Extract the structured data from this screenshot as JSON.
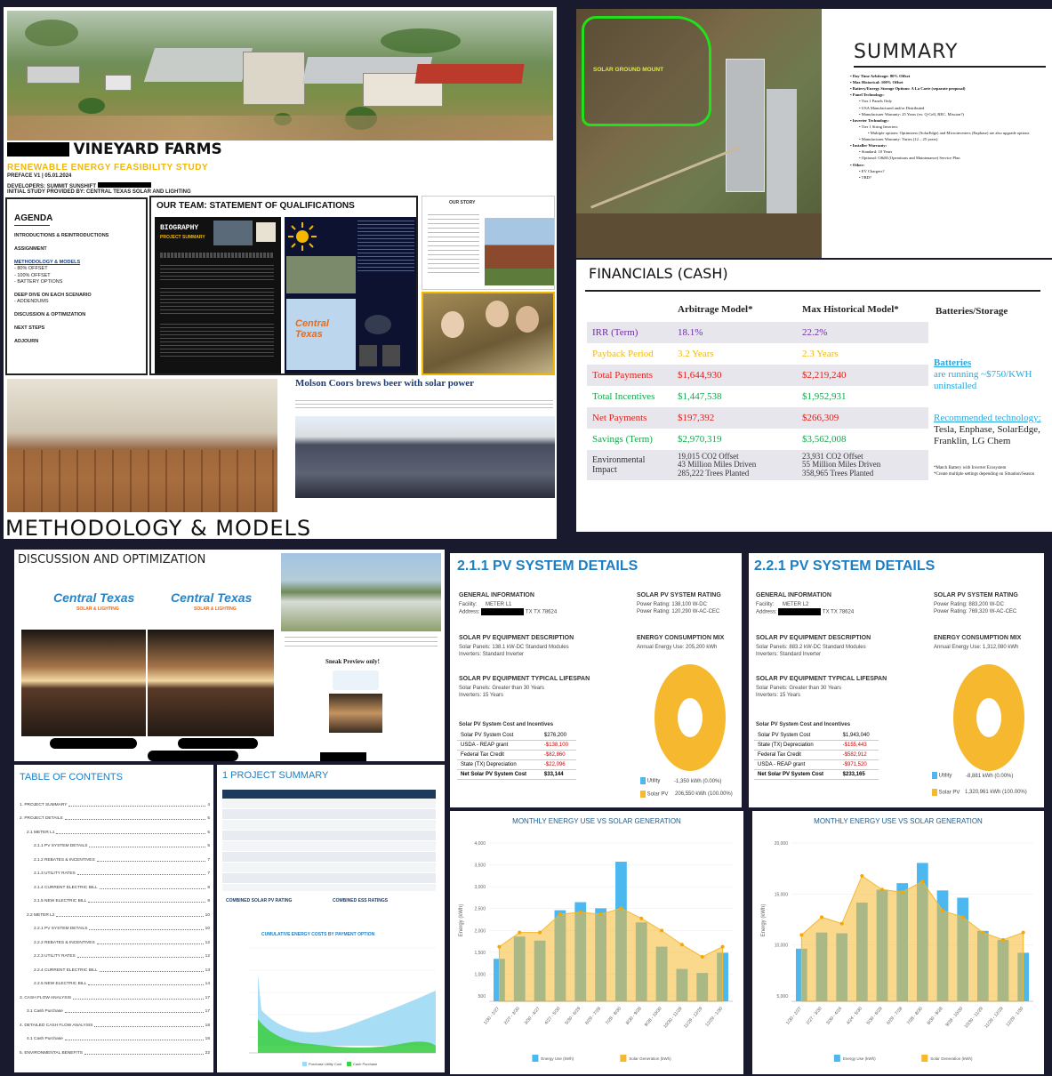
{
  "vineyard": {
    "title": "VINEYARD FARMS",
    "subtitle": "RENEWABLE ENERGY FEASIBILITY STUDY",
    "preface": "PREFACE V1 | 05.01.2024",
    "developers": "DEVELOPERS: SUMMIT SUNSHIFT",
    "initial_study": "INITIAL STUDY PROVIDED BY: CENTRAL TEXAS SOLAR AND LIGHTING"
  },
  "agenda": {
    "heading": "AGENDA",
    "items": [
      "INTRODUCTIONS & REINTRODUCTIONS",
      "ASSIGNMENT",
      "METHODOLOGY & MODELS",
      "- 80% OFFSET",
      "- 100% OFFSET",
      "- BATTERY OPTIONS",
      "DEEP DIVE ON EACH SCENARIO",
      "- ADDENDUMS",
      "DISCUSSION & OPTIMIZATION",
      "NEXT STEPS",
      "ADJOURN"
    ]
  },
  "team": {
    "heading": "OUR TEAM: STATEMENT OF QUALIFICATIONS",
    "bio_label": "BIOGRAPHY",
    "bio_sub": "PROJECT SUMMARY",
    "logo_text": "Central Texas",
    "our_story": "OUR STORY"
  },
  "news": {
    "headline": "Molson Coors brews beer with solar power"
  },
  "methodology": {
    "heading": "METHODOLOGY & MODELS"
  },
  "aerial": {
    "label": "SOLAR GROUND MOUNT"
  },
  "summary": {
    "heading": "SUMMARY",
    "items": [
      "Day Time Arbitrage: 80% Offset",
      "Max Historical: 100% Offset",
      "Battery/Energy Storage Options: A La Carte (separate proposal)",
      "Panel Technology:",
      "Tier 1 Panels Only",
      "USA Manufactured and/or Distributed",
      "Manufacturer Warranty: 25 Years (ex: Q-Cell, REC, Mission?)",
      "Inverter Technology:",
      "Tier 1 String Inverters",
      "Multiple options: Optimizers (SolarEdge) and Microinverters (Enphase) are also upgrade options",
      "Manufacturer Warranty: Varies (12 – 25 years)",
      "Installer Warranty:",
      "Standard: 10 Years",
      "Optional: O&M (Operations and Maintenance) Service Plan",
      "Other:",
      "EV Chargers?",
      "TBD?"
    ]
  },
  "financials": {
    "heading": "FINANCIALS (CASH)",
    "columns": [
      "",
      "Arbitrage Model*",
      "Max Historical Model*",
      "Batteries/Storage"
    ],
    "rows": [
      {
        "label": "IRR (Term)",
        "a": "18.1%",
        "b": "22.2%",
        "color": "#7030a0"
      },
      {
        "label": "Payback Period",
        "a": "3.2 Years",
        "b": "2.3 Years",
        "color": "#f5b800"
      },
      {
        "label": "Total Payments",
        "a": "$1,644,930",
        "b": "$2,219,240",
        "color": "#e0201b"
      },
      {
        "label": "Total Incentives",
        "a": "$1,447,538",
        "b": "$1,952,931",
        "color": "#11a84a"
      },
      {
        "label": "Net Payments",
        "a": "$197,392",
        "b": "$266,309",
        "color": "#e0201b"
      },
      {
        "label": "Savings (Term)",
        "a": "$2,970,319",
        "b": "$3,562,008",
        "color": "#11a84a"
      },
      {
        "label": "Environmental Impact",
        "a": "19,015 CO2 Offset\n43 Million Miles Driven\n285,222 Trees Planted",
        "b": "23,931 CO2 Offset\n55 Million Miles Driven\n358,965 Trees Planted",
        "color": "#333333"
      }
    ],
    "batteries_title": "Batteries",
    "batteries_text": "are running ~$750/KWH uninstalled",
    "recommended_title": "Recommended technology:",
    "recommended_text": "Tesla, Enphase, SolarEdge, Franklin, LG Chem",
    "note1": "*Match Battery with Inverter Ecosystem",
    "note2": "*Create multiple settings depending on Situation/Season"
  },
  "discussion": {
    "heading": "DISCUSSION AND OPTIMIZATION",
    "logo_text": "Central Texas",
    "logo_sub": "SOLAR & LIGHTING",
    "sneak": "Sneak Preview only!"
  },
  "toc": {
    "heading": "TABLE OF CONTENTS",
    "items": [
      {
        "t": "1. PROJECT SUMMARY",
        "p": "4"
      },
      {
        "t": "2. PROJECT DETAILS",
        "p": "5"
      },
      {
        "t": "2.1 METER L1",
        "p": "5"
      },
      {
        "t": "2.1.1 PV SYSTEM DETAILS",
        "p": "5"
      },
      {
        "t": "2.1.2 REBATES & INCENTIVES",
        "p": "7"
      },
      {
        "t": "2.1.3 UTILITY RATES",
        "p": "7"
      },
      {
        "t": "2.1.4 CURRENT ELECTRIC BILL",
        "p": "8"
      },
      {
        "t": "2.1.5 NEW ELECTRIC BILL",
        "p": "9"
      },
      {
        "t": "2.2 METER L2",
        "p": "10"
      },
      {
        "t": "2.2.1 PV SYSTEM DETAILS",
        "p": "10"
      },
      {
        "t": "2.2.2 REBATES & INCENTIVES",
        "p": "12"
      },
      {
        "t": "2.2.3 UTILITY RATES",
        "p": "12"
      },
      {
        "t": "2.2.4 CURRENT ELECTRIC BILL",
        "p": "13"
      },
      {
        "t": "2.2.5 NEW ELECTRIC BILL",
        "p": "14"
      },
      {
        "t": "3. CASH FLOW ANALYSIS",
        "p": "17"
      },
      {
        "t": "3.1 Cash Purchase",
        "p": "17"
      },
      {
        "t": "4. DETAILED CASH FLOW ANALYSIS",
        "p": "18"
      },
      {
        "t": "4.1 Cash Purchase",
        "p": "18"
      },
      {
        "t": "5. ENVIRONMENTAL BENEFITS",
        "p": "22"
      }
    ]
  },
  "projsum": {
    "heading": "1 PROJECT SUMMARY",
    "combined_pv": "COMBINED SOLAR PV RATING",
    "combined_ess": "COMBINED ESS RATINGS",
    "chart_title": "CUMULATIVE ENERGY COSTS BY PAYMENT OPTION",
    "legend": [
      "Purchase Utility Cost",
      "Cash Purchase"
    ]
  },
  "pv1": {
    "heading": "2.1.1 PV SYSTEM DETAILS",
    "gen_info": "GENERAL INFORMATION",
    "facility": "Facility:",
    "facility_val": "METER L1",
    "address": "Address:",
    "address_val": "TX TX 78624",
    "rating_h": "SOLAR PV SYSTEM RATING",
    "rating1": "Power Rating: 138,100 W-DC",
    "rating2": "Power Rating: 120,290 W-AC-CEC",
    "equip_h": "SOLAR PV EQUIPMENT DESCRIPTION",
    "panels": "Solar Panels: 138.1 kW-DC Standard Modules",
    "inverters": "Inverters: Standard Inverter",
    "mix_h": "ENERGY CONSUMPTION MIX",
    "annual": "Annual Energy Use: 205,200 kWh",
    "life_h": "SOLAR PV EQUIPMENT TYPICAL LIFESPAN",
    "life1": "Solar Panels: Greater than 30 Years",
    "life2": "Inverters: 15 Years",
    "cost_h": "Solar PV System Cost and Incentives",
    "costs": [
      {
        "k": "Solar PV System Cost",
        "v": "$276,200",
        "neg": false
      },
      {
        "k": "USDA - REAP grant",
        "v": "-$138,100",
        "neg": true
      },
      {
        "k": "Federal Tax Credit",
        "v": "-$82,860",
        "neg": true
      },
      {
        "k": "State (TX) Depreciation",
        "v": "-$22,096",
        "neg": true
      }
    ],
    "net_k": "Net Solar PV System Cost",
    "net_v": "$33,144",
    "leg_utility": "Utility",
    "leg_utility_val": "-1,350 kWh (0.00%)",
    "leg_solar": "Solar PV",
    "leg_solar_val": "206,550 kWh (100.00%)"
  },
  "pv2": {
    "heading": "2.2.1 PV SYSTEM DETAILS",
    "gen_info": "GENERAL INFORMATION",
    "facility": "Facility:",
    "facility_val": "METER L2",
    "address": "Address:",
    "address_val": "TX TX 78624",
    "rating_h": "SOLAR PV SYSTEM RATING",
    "rating1": "Power Rating: 883,200 W-DC",
    "rating2": "Power Rating: 769,320 W-AC-CEC",
    "equip_h": "SOLAR PV EQUIPMENT DESCRIPTION",
    "panels": "Solar Panels: 883.2 kW-DC Standard Modules",
    "inverters": "Inverters: Standard Inverter",
    "mix_h": "ENERGY CONSUMPTION MIX",
    "annual": "Annual Energy Use: 1,312,080 kWh",
    "life_h": "SOLAR PV EQUIPMENT TYPICAL LIFESPAN",
    "life1": "Solar Panels: Greater than 30 Years",
    "life2": "Inverters: 15 Years",
    "cost_h": "Solar PV System Cost and Incentives",
    "costs": [
      {
        "k": "Solar PV System Cost",
        "v": "$1,943,040",
        "neg": false
      },
      {
        "k": "State (TX) Depreciation",
        "v": "-$155,443",
        "neg": true
      },
      {
        "k": "Federal Tax Credit",
        "v": "-$582,912",
        "neg": true
      },
      {
        "k": "USDA - REAP grant",
        "v": "-$971,520",
        "neg": true
      }
    ],
    "net_k": "Net Solar PV System Cost",
    "net_v": "$233,165",
    "leg_utility": "Utility",
    "leg_utility_val": "-8,881 kWh (0.00%)",
    "leg_solar": "Solar PV",
    "leg_solar_val": "1,320,961 kWh (100.00%)"
  },
  "chart_data": [
    {
      "type": "bar",
      "title": "MONTHLY ENERGY USE VS SOLAR GENERATION",
      "ylabel": "Energy (kWh)",
      "ylim": [
        0,
        40000
      ],
      "yticks": [
        "4,000",
        "3,500",
        "3,000",
        "2,500",
        "2,000",
        "1,500",
        "1,000",
        "500"
      ],
      "categories": [
        "1/30 - 2/27",
        "2/27 - 3/30",
        "3/30 - 4/27",
        "4/27 - 5/30",
        "5/30 - 6/29",
        "6/29 - 7/28",
        "7/28 - 8/30",
        "8/30 - 9/28",
        "9/28 - 10/30",
        "10/30 - 11/29",
        "11/29 - 12/29",
        "12/29 - 1/30"
      ],
      "series": [
        {
          "name": "Energy Use (kWh)",
          "type": "bar",
          "color": "#4db8f0",
          "values": [
            10500,
            16000,
            15000,
            22500,
            24500,
            23000,
            34500,
            19500,
            13500,
            8000,
            7000,
            12000
          ]
        },
        {
          "name": "Solar Generation (kWh)",
          "type": "area",
          "color": "#f5b82e",
          "values": [
            13500,
            17000,
            17000,
            21500,
            22000,
            21500,
            23000,
            20500,
            17500,
            14000,
            11000,
            13500
          ]
        }
      ]
    },
    {
      "type": "bar",
      "title": "MONTHLY ENERGY USE VS SOLAR GENERATION",
      "ylabel": "Energy (kWh)",
      "ylim": [
        0,
        200000
      ],
      "yticks": [
        "20,000",
        "15,000",
        "10,000",
        "5,000"
      ],
      "categories": [
        "1/30 - 2/27",
        "2/27 - 3/30",
        "3/30 - 4/24",
        "4/24 - 5/30",
        "5/30 - 6/29",
        "6/29 - 7/28",
        "7/28 - 8/30",
        "8/30 - 9/28",
        "9/28 - 10/30",
        "10/30 - 11/29",
        "11/29 - 12/29",
        "12/29 - 1/30"
      ],
      "series": [
        {
          "name": "Energy Use (kWh)",
          "type": "bar",
          "color": "#4db8f0",
          "values": [
            65000,
            85000,
            84000,
            122000,
            138000,
            146000,
            171000,
            137000,
            128000,
            87000,
            76000,
            60000
          ]
        },
        {
          "name": "Solar Generation (kWh)",
          "type": "area",
          "color": "#f5b82e",
          "values": [
            82000,
            104000,
            96000,
            155000,
            138000,
            135000,
            148000,
            112000,
            104000,
            85000,
            76000,
            85000
          ]
        }
      ]
    }
  ]
}
